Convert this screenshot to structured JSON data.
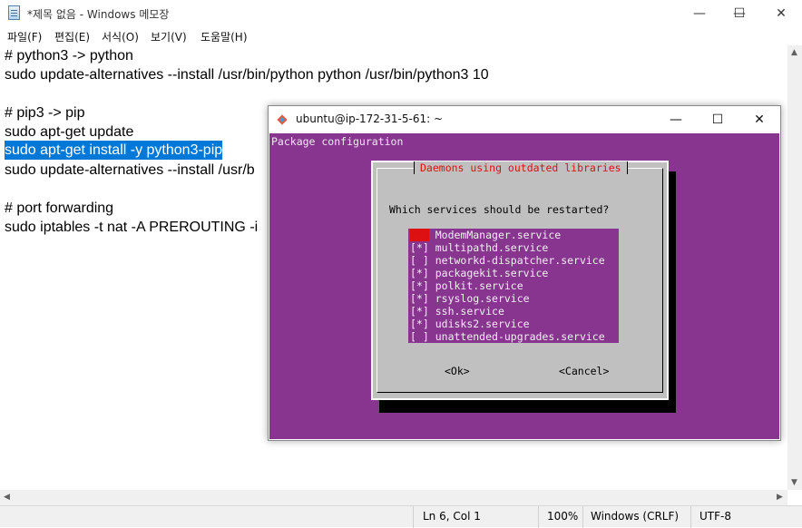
{
  "notepad": {
    "title": "*제목 없음 - Windows 메모장",
    "window_controls": {
      "minimize": "—",
      "maximize": "☐",
      "close": "✕"
    },
    "menu": [
      "파일(F)",
      "편집(E)",
      "서식(O)",
      "보기(V)",
      "도움말(H)"
    ],
    "lines": [
      {
        "text": "# python3 -> python",
        "selected": false
      },
      {
        "text": "sudo update-alternatives --install /usr/bin/python python /usr/bin/python3 10",
        "selected": false
      },
      {
        "text": "",
        "selected": false
      },
      {
        "text": "# pip3 -> pip",
        "selected": false
      },
      {
        "text": "sudo apt-get update",
        "selected": false
      },
      {
        "text": "sudo apt-get install -y python3-pip",
        "selected": true
      },
      {
        "text": "sudo update-alternatives --install /usr/b",
        "selected": false
      },
      {
        "text": "",
        "selected": false
      },
      {
        "text": "# port forwarding",
        "selected": false
      },
      {
        "text": "sudo iptables -t nat -A PREROUTING -i",
        "selected": false
      }
    ],
    "status": {
      "position": "Ln 6, Col 1",
      "zoom": "100%",
      "line_ending": "Windows (CRLF)",
      "encoding": "UTF-8"
    }
  },
  "terminal": {
    "title": "ubuntu@ip-172-31-5-61: ~",
    "window_controls": {
      "minimize": "—",
      "maximize": "☐",
      "close": "✕"
    },
    "header": "Package configuration",
    "dialog": {
      "title": "Daemons using outdated libraries",
      "question": "Which services should be restarted?",
      "services": [
        {
          "mark": "[*]",
          "name": "ModemManager.service",
          "cursor": true
        },
        {
          "mark": "[*]",
          "name": "multipathd.service",
          "cursor": false
        },
        {
          "mark": "[ ]",
          "name": "networkd-dispatcher.service",
          "cursor": false
        },
        {
          "mark": "[*]",
          "name": "packagekit.service",
          "cursor": false
        },
        {
          "mark": "[*]",
          "name": "polkit.service",
          "cursor": false
        },
        {
          "mark": "[*]",
          "name": "rsyslog.service",
          "cursor": false
        },
        {
          "mark": "[*]",
          "name": "ssh.service",
          "cursor": false
        },
        {
          "mark": "[*]",
          "name": "udisks2.service",
          "cursor": false
        },
        {
          "mark": "[ ]",
          "name": "unattended-upgrades.service",
          "cursor": false
        }
      ],
      "ok_label": "<Ok>",
      "cancel_label": "<Cancel>"
    }
  },
  "colors": {
    "terminal_bg": "#87358f",
    "selection": "#0078d7",
    "dialog_bg": "#c0c0c0",
    "dialog_title": "#dd1111"
  }
}
